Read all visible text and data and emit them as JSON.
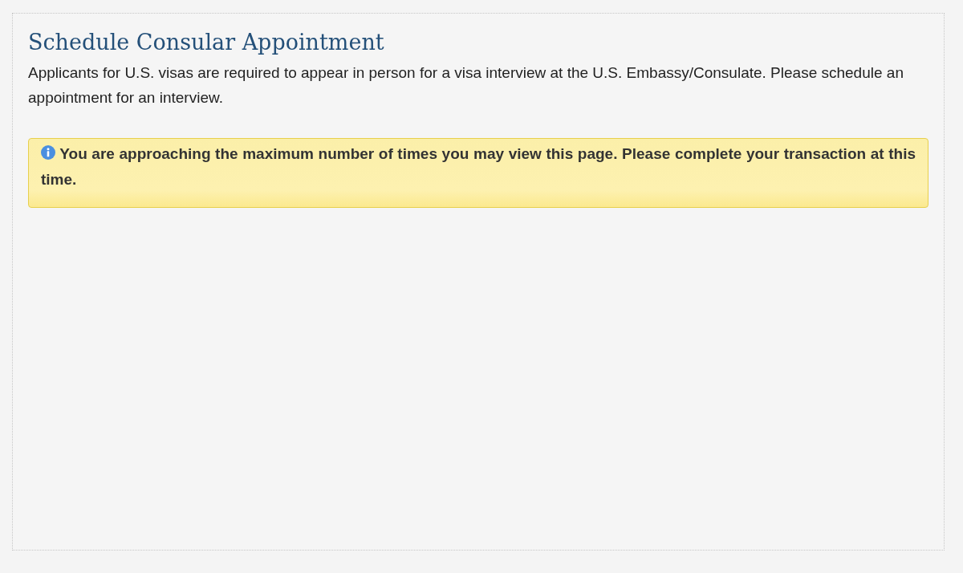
{
  "page": {
    "title": "Schedule Consular Appointment",
    "intro": "Applicants for U.S. visas are required to appear in person for a visa interview at the U.S. Embassy/Consulate. Please schedule an appointment for an interview."
  },
  "alert": {
    "kind": "warning",
    "text": "You are approaching the maximum number of times you may view this page. Please complete your transaction at this time."
  }
}
